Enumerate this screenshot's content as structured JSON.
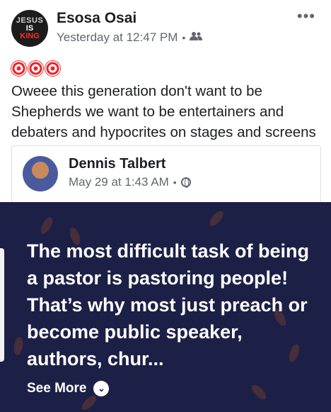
{
  "post": {
    "avatar_text": [
      "JESUS",
      "IS",
      "KING"
    ],
    "author": "Esosa Osai",
    "timestamp": "Yesterday at 12:47 PM",
    "separator": "•",
    "audience_icon": "friends-icon",
    "more_icon": "more-options-icon",
    "emoji_count": 3,
    "text": "Oweee this generation don't want to be Shepherds we want to be entertainers and debaters and hypocrites on stages and screens"
  },
  "shared": {
    "author": "Dennis Talbert",
    "timestamp": "May 29 at 1:43 AM",
    "separator": "•",
    "audience_icon": "globe-icon",
    "quote": "The most difficult task of being a pastor is pastoring people! That’s why most just preach or become public speaker, authors, chur...",
    "see_more": "See More",
    "panel_color": "#1c2046"
  }
}
